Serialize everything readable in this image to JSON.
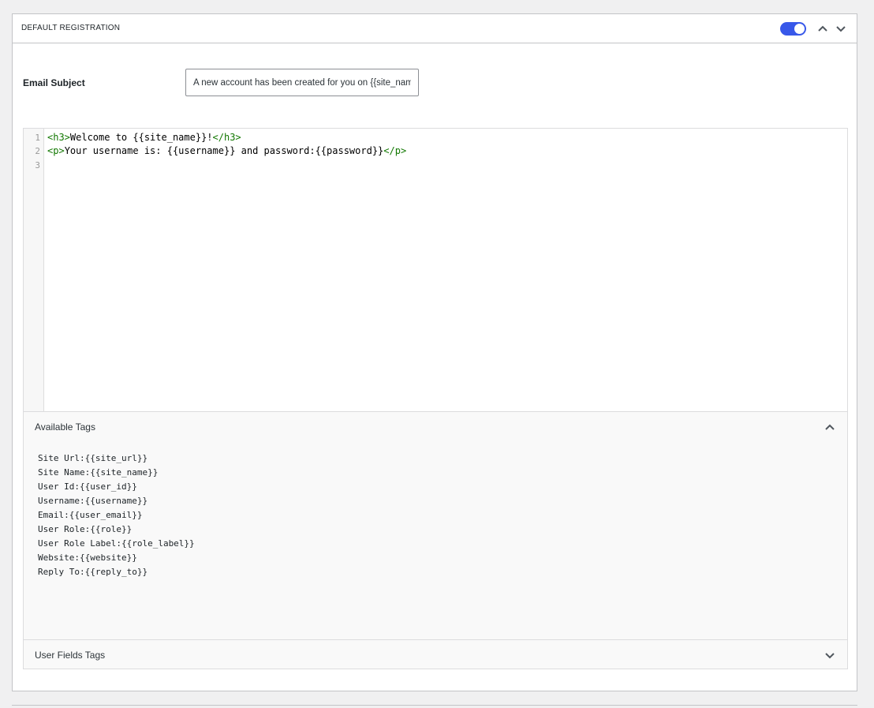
{
  "panel": {
    "title": "DEFAULT REGISTRATION",
    "toggle_on": true,
    "accent_color": "#3858e9"
  },
  "subject": {
    "label": "Email Subject",
    "value": "A new account has been created for you on {{site_name}}"
  },
  "editor": {
    "line_numbers": [
      "1",
      "2",
      "3"
    ],
    "lines": [
      {
        "open": "<h3>",
        "text": "Welcome to {{site_name}}!",
        "close": "</h3>"
      },
      {
        "open": "<p>",
        "text": "Your username is: {{username}} and password:{{password}}",
        "close": "</p>"
      },
      {
        "open": "",
        "text": "",
        "close": ""
      }
    ]
  },
  "available_tags": {
    "title": "Available Tags",
    "expanded": true,
    "items": [
      "Site Url:{{site_url}}",
      "Site Name:{{site_name}}",
      "User Id:{{user_id}}",
      "Username:{{username}}",
      "Email:{{user_email}}",
      "User Role:{{role}}",
      "User Role Label:{{role_label}}",
      "Website:{{website}}",
      "Reply To:{{reply_to}}"
    ]
  },
  "user_fields_tags": {
    "title": "User Fields Tags",
    "expanded": false
  },
  "icons": {
    "header_up": "chevron-up-icon",
    "header_down": "chevron-down-icon",
    "available_tags_toggle": "chevron-up-icon",
    "user_fields_toggle": "chevron-down-icon"
  }
}
